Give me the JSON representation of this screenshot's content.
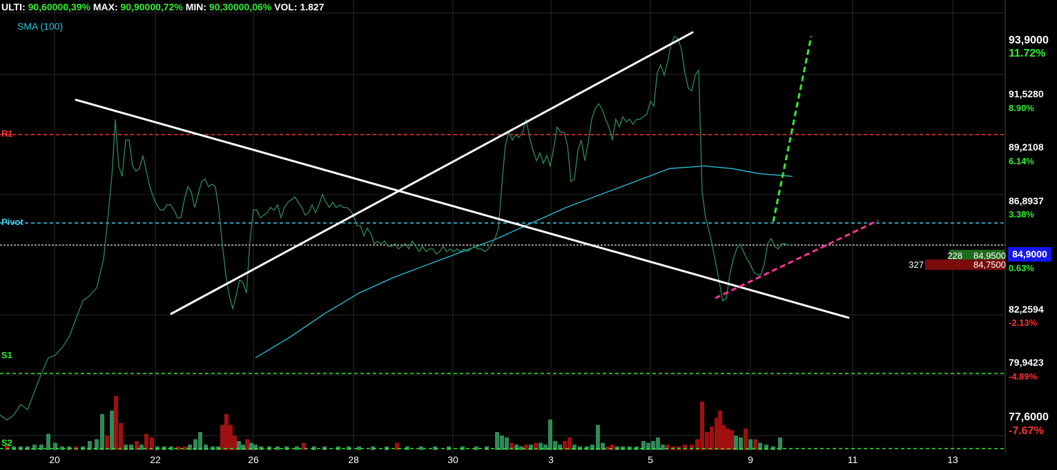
{
  "header": {
    "ulti_label": "ULTI:",
    "ulti_value": "90,60000,39%",
    "max_label": "MAX:",
    "max_value": "90,90000,72%",
    "min_label": "MIN:",
    "min_value": "90,30000,06%",
    "vol_label": "VOL:",
    "vol_value": "1.827"
  },
  "sma_label": "SMA (100)",
  "levels": {
    "r1": {
      "label": "R1",
      "value": 89.21,
      "color": "#ff3333"
    },
    "pivot": {
      "label": "Pivot",
      "value": 85.8,
      "color": "#40d0f0"
    },
    "s1": {
      "label": "S1",
      "value": 80.0,
      "color": "#33ee33"
    },
    "s2": {
      "label": "S2",
      "value": 77.1,
      "color": "#33ee33"
    }
  },
  "price_axis": [
    {
      "price": "93,9000",
      "pct": "11.72%",
      "pct_color": "#33ee33",
      "big": true
    },
    {
      "price": "91,5280",
      "pct": "8.90%",
      "pct_color": "#33ee33",
      "big": false
    },
    {
      "price": "89,2108",
      "pct": "6.14%",
      "pct_color": "#33ee33",
      "big": false
    },
    {
      "price": "86,8937",
      "pct": "3.38%",
      "pct_color": "#33ee33",
      "big": false
    },
    {
      "price": "84,9000",
      "pct": "0.63%",
      "pct_color": "#33ee33",
      "big": false
    },
    {
      "price": "82,2594",
      "pct": "-2.13%",
      "pct_color": "#ff3333",
      "big": false
    },
    {
      "price": "79,9423",
      "pct": "-4.89%",
      "pct_color": "#ff3333",
      "big": false
    },
    {
      "price": "77,6000",
      "pct": "-7.67%",
      "pct_color": "#ff3333",
      "big": true
    }
  ],
  "order_book": {
    "bid_qty": "228",
    "bid_price": "84,9500",
    "ask_qty": "327",
    "ask_price": "84,7500"
  },
  "current_price": "84,9000",
  "colors": {
    "up": "#2e8b57",
    "down": "#a01010",
    "price_line": "#2e8b57",
    "sma": "#26c6da",
    "trendline": "#ffffff",
    "green_dash": "#33ee33",
    "pink_dash": "#ff3399",
    "grid": "#2a2a2a"
  },
  "chart_data": {
    "type": "line",
    "xlabel": "",
    "ylabel": "",
    "x_ticks": [
      "20",
      "22",
      "26",
      "28",
      "30",
      "3",
      "5",
      "9",
      "11",
      "13"
    ],
    "ylim": [
      77.1,
      94.4
    ],
    "grid": true,
    "price_series": [
      [
        0,
        78.4
      ],
      [
        10,
        78.2
      ],
      [
        20,
        78.4
      ],
      [
        30,
        78.8
      ],
      [
        40,
        78.6
      ],
      [
        50,
        79.3
      ],
      [
        60,
        80.0
      ],
      [
        70,
        80.6
      ],
      [
        80,
        80.7
      ],
      [
        90,
        81.0
      ],
      [
        100,
        81.4
      ],
      [
        110,
        82.1
      ],
      [
        120,
        82.8
      ],
      [
        130,
        83.0
      ],
      [
        140,
        83.3
      ],
      [
        150,
        84.4
      ],
      [
        157,
        86.2
      ],
      [
        162,
        87.6
      ],
      [
        167,
        89.8
      ],
      [
        172,
        88.0
      ],
      [
        177,
        87.6
      ],
      [
        182,
        89.0
      ],
      [
        187,
        89.0
      ],
      [
        192,
        88.0
      ],
      [
        197,
        87.8
      ],
      [
        202,
        87.9
      ],
      [
        207,
        88.4
      ],
      [
        212,
        87.8
      ],
      [
        217,
        87.2
      ],
      [
        222,
        86.8
      ],
      [
        227,
        86.5
      ],
      [
        232,
        86.3
      ],
      [
        237,
        86.3
      ],
      [
        242,
        86.5
      ],
      [
        247,
        86.5
      ],
      [
        252,
        86.3
      ],
      [
        257,
        86.0
      ],
      [
        262,
        86.0
      ],
      [
        267,
        86.7
      ],
      [
        272,
        87.2
      ],
      [
        277,
        87.0
      ],
      [
        282,
        86.4
      ],
      [
        287,
        86.9
      ],
      [
        292,
        87.4
      ],
      [
        297,
        87.5
      ],
      [
        302,
        87.2
      ],
      [
        307,
        87.3
      ],
      [
        312,
        87.2
      ],
      [
        317,
        86.3
      ],
      [
        322,
        85.0
      ],
      [
        327,
        83.8
      ],
      [
        332,
        83.0
      ],
      [
        337,
        82.5
      ],
      [
        342,
        83.0
      ],
      [
        347,
        83.6
      ],
      [
        352,
        83.5
      ],
      [
        357,
        83.1
      ],
      [
        362,
        85.1
      ],
      [
        367,
        86.3
      ],
      [
        372,
        86.3
      ],
      [
        377,
        86.0
      ],
      [
        382,
        86.1
      ],
      [
        387,
        86.2
      ],
      [
        392,
        86.4
      ],
      [
        397,
        86.3
      ],
      [
        402,
        86.5
      ],
      [
        407,
        86.0
      ],
      [
        412,
        86.4
      ],
      [
        417,
        86.6
      ],
      [
        422,
        86.7
      ],
      [
        427,
        86.8
      ],
      [
        432,
        86.6
      ],
      [
        437,
        86.4
      ],
      [
        442,
        86.1
      ],
      [
        447,
        86.2
      ],
      [
        452,
        86.5
      ],
      [
        457,
        86.2
      ],
      [
        462,
        86.5
      ],
      [
        467,
        86.9
      ],
      [
        472,
        86.6
      ],
      [
        477,
        86.4
      ],
      [
        482,
        86.6
      ],
      [
        487,
        86.4
      ],
      [
        492,
        86.5
      ],
      [
        497,
        86.4
      ],
      [
        502,
        86.4
      ],
      [
        507,
        86.3
      ],
      [
        512,
        86.1
      ],
      [
        517,
        85.7
      ],
      [
        522,
        85.7
      ],
      [
        527,
        85.3
      ],
      [
        532,
        85.6
      ],
      [
        537,
        85.4
      ],
      [
        542,
        85.0
      ],
      [
        547,
        85.1
      ],
      [
        552,
        85.0
      ],
      [
        557,
        85.1
      ],
      [
        562,
        84.9
      ],
      [
        567,
        84.9
      ],
      [
        572,
        85.0
      ],
      [
        577,
        84.8
      ],
      [
        582,
        84.9
      ],
      [
        587,
        85.0
      ],
      [
        592,
        84.8
      ],
      [
        597,
        85.1
      ],
      [
        602,
        84.9
      ],
      [
        607,
        84.7
      ],
      [
        612,
        84.9
      ],
      [
        617,
        84.7
      ],
      [
        622,
        84.8
      ],
      [
        627,
        84.8
      ],
      [
        632,
        84.6
      ],
      [
        637,
        84.7
      ],
      [
        642,
        84.9
      ],
      [
        647,
        84.7
      ],
      [
        652,
        84.8
      ],
      [
        657,
        84.7
      ],
      [
        662,
        84.8
      ],
      [
        667,
        84.7
      ],
      [
        672,
        84.8
      ],
      [
        677,
        84.7
      ],
      [
        682,
        84.8
      ],
      [
        687,
        84.9
      ],
      [
        692,
        84.8
      ],
      [
        697,
        84.8
      ],
      [
        702,
        84.7
      ],
      [
        707,
        84.8
      ],
      [
        712,
        85.0
      ],
      [
        717,
        85.2
      ],
      [
        722,
        85.6
      ],
      [
        727,
        87.3
      ],
      [
        732,
        88.8
      ],
      [
        737,
        89.3
      ],
      [
        742,
        89.0
      ],
      [
        747,
        89.2
      ],
      [
        752,
        89.1
      ],
      [
        757,
        89.3
      ],
      [
        762,
        89.8
      ],
      [
        767,
        89.1
      ],
      [
        772,
        88.6
      ],
      [
        777,
        88.2
      ],
      [
        782,
        88.5
      ],
      [
        787,
        88.1
      ],
      [
        792,
        88.4
      ],
      [
        797,
        88.0
      ],
      [
        802,
        88.7
      ],
      [
        807,
        89.5
      ],
      [
        812,
        89.3
      ],
      [
        817,
        89.3
      ],
      [
        822,
        88.8
      ],
      [
        827,
        87.4
      ],
      [
        832,
        87.5
      ],
      [
        837,
        88.6
      ],
      [
        842,
        89.0
      ],
      [
        847,
        88.2
      ],
      [
        852,
        88.9
      ],
      [
        857,
        89.8
      ],
      [
        862,
        90.2
      ],
      [
        867,
        90.4
      ],
      [
        872,
        90.2
      ],
      [
        877,
        89.8
      ],
      [
        882,
        89.5
      ],
      [
        887,
        89.0
      ],
      [
        892,
        89.8
      ],
      [
        897,
        89.5
      ],
      [
        902,
        89.9
      ],
      [
        907,
        89.7
      ],
      [
        912,
        89.8
      ],
      [
        917,
        89.6
      ],
      [
        922,
        89.8
      ],
      [
        927,
        89.8
      ],
      [
        932,
        89.9
      ],
      [
        937,
        90.0
      ],
      [
        942,
        90.5
      ],
      [
        947,
        90.3
      ],
      [
        952,
        91.6
      ],
      [
        957,
        91.9
      ],
      [
        962,
        91.5
      ],
      [
        967,
        92.0
      ],
      [
        972,
        92.7
      ],
      [
        977,
        93.0
      ],
      [
        982,
        92.9
      ],
      [
        987,
        92.5
      ],
      [
        992,
        91.6
      ],
      [
        997,
        91.0
      ],
      [
        1002,
        90.9
      ],
      [
        1007,
        91.5
      ],
      [
        1012,
        91.7
      ],
      [
        1017,
        87.0
      ],
      [
        1022,
        86.0
      ],
      [
        1027,
        85.5
      ],
      [
        1032,
        84.9
      ],
      [
        1037,
        84.2
      ],
      [
        1042,
        83.5
      ],
      [
        1047,
        82.8
      ],
      [
        1052,
        82.9
      ],
      [
        1057,
        83.8
      ],
      [
        1062,
        84.4
      ],
      [
        1067,
        84.8
      ],
      [
        1072,
        85.0
      ],
      [
        1077,
        84.7
      ],
      [
        1082,
        84.4
      ],
      [
        1087,
        84.2
      ],
      [
        1092,
        83.9
      ],
      [
        1097,
        83.8
      ],
      [
        1102,
        83.8
      ],
      [
        1107,
        84.2
      ],
      [
        1112,
        85.0
      ],
      [
        1117,
        85.2
      ],
      [
        1122,
        84.9
      ],
      [
        1127,
        84.8
      ],
      [
        1132,
        85.0
      ],
      [
        1137,
        85.0
      ],
      [
        1142,
        84.95
      ]
    ],
    "sma_series": [
      [
        370,
        80.6
      ],
      [
        420,
        81.4
      ],
      [
        470,
        82.3
      ],
      [
        520,
        83.1
      ],
      [
        570,
        83.7
      ],
      [
        620,
        84.2
      ],
      [
        670,
        84.7
      ],
      [
        720,
        85.2
      ],
      [
        770,
        85.8
      ],
      [
        820,
        86.4
      ],
      [
        870,
        86.9
      ],
      [
        920,
        87.4
      ],
      [
        970,
        87.9
      ],
      [
        1020,
        88.0
      ],
      [
        1060,
        87.9
      ],
      [
        1100,
        87.7
      ],
      [
        1148,
        87.6
      ]
    ],
    "trendlines": [
      {
        "from": [
          110,
          90.55
        ],
        "to": [
          1229,
          82.15
        ]
      },
      {
        "from": [
          248,
          82.3
        ],
        "to": [
          1003,
          93.15
        ]
      }
    ],
    "projections": [
      {
        "from": [
          1120,
          85.85
        ],
        "to": [
          1175,
          93.0
        ],
        "color": "green"
      },
      {
        "from": [
          1036,
          82.9
        ],
        "to": [
          1272,
          85.9
        ],
        "color": "pink"
      }
    ],
    "volume_bars": [
      [
        10,
        0.3,
        "down"
      ],
      [
        20,
        0.2,
        "up"
      ],
      [
        30,
        0.2,
        "up"
      ],
      [
        40,
        0.2,
        "up"
      ],
      [
        50,
        0.3,
        "up"
      ],
      [
        60,
        0.3,
        "up"
      ],
      [
        70,
        0.9,
        "up"
      ],
      [
        80,
        0.4,
        "up"
      ],
      [
        90,
        0.2,
        "up"
      ],
      [
        100,
        0.2,
        "up"
      ],
      [
        110,
        0.2,
        "down"
      ],
      [
        120,
        0.2,
        "up"
      ],
      [
        130,
        0.5,
        "up"
      ],
      [
        140,
        0.6,
        "up"
      ],
      [
        148,
        2.0,
        "up"
      ],
      [
        155,
        0.8,
        "down"
      ],
      [
        162,
        2.2,
        "up"
      ],
      [
        168,
        3.0,
        "down"
      ],
      [
        175,
        1.5,
        "down"
      ],
      [
        182,
        0.3,
        "up"
      ],
      [
        190,
        0.3,
        "up"
      ],
      [
        198,
        0.5,
        "down"
      ],
      [
        205,
        0.3,
        "up"
      ],
      [
        212,
        0.9,
        "down"
      ],
      [
        220,
        0.7,
        "down"
      ],
      [
        228,
        0.2,
        "up"
      ],
      [
        238,
        0.2,
        "up"
      ],
      [
        248,
        0.2,
        "up"
      ],
      [
        258,
        0.2,
        "down"
      ],
      [
        268,
        0.2,
        "down"
      ],
      [
        275,
        0.3,
        "up"
      ],
      [
        283,
        0.6,
        "up"
      ],
      [
        290,
        1.0,
        "up"
      ],
      [
        298,
        0.3,
        "up"
      ],
      [
        308,
        0.2,
        "up"
      ],
      [
        316,
        0.2,
        "up"
      ],
      [
        322,
        1.4,
        "down"
      ],
      [
        328,
        2.0,
        "down"
      ],
      [
        334,
        1.4,
        "down"
      ],
      [
        340,
        0.8,
        "down"
      ],
      [
        346,
        0.5,
        "up"
      ],
      [
        352,
        0.3,
        "up"
      ],
      [
        358,
        0.6,
        "down"
      ],
      [
        364,
        0.4,
        "up"
      ],
      [
        370,
        0.3,
        "up"
      ],
      [
        378,
        0.2,
        "up"
      ],
      [
        390,
        0.2,
        "up"
      ],
      [
        402,
        0.2,
        "up"
      ],
      [
        415,
        0.2,
        "up"
      ],
      [
        430,
        0.2,
        "up"
      ],
      [
        440,
        0.4,
        "down"
      ],
      [
        455,
        0.2,
        "up"
      ],
      [
        470,
        0.2,
        "up"
      ],
      [
        490,
        0.2,
        "up"
      ],
      [
        505,
        0.2,
        "up"
      ],
      [
        520,
        0.2,
        "up"
      ],
      [
        540,
        0.2,
        "up"
      ],
      [
        560,
        0.2,
        "up"
      ],
      [
        575,
        0.4,
        "down"
      ],
      [
        590,
        0.2,
        "up"
      ],
      [
        610,
        0.2,
        "up"
      ],
      [
        630,
        0.2,
        "up"
      ],
      [
        650,
        0.2,
        "up"
      ],
      [
        670,
        0.2,
        "up"
      ],
      [
        690,
        0.2,
        "up"
      ],
      [
        705,
        0.2,
        "up"
      ],
      [
        720,
        1.0,
        "up"
      ],
      [
        727,
        0.8,
        "up"
      ],
      [
        734,
        0.7,
        "up"
      ],
      [
        741,
        0.4,
        "down"
      ],
      [
        748,
        0.3,
        "up"
      ],
      [
        755,
        0.2,
        "up"
      ],
      [
        762,
        0.3,
        "down"
      ],
      [
        769,
        0.3,
        "up"
      ],
      [
        776,
        0.4,
        "down"
      ],
      [
        783,
        0.4,
        "up"
      ],
      [
        790,
        0.3,
        "up"
      ],
      [
        797,
        1.7,
        "up"
      ],
      [
        804,
        0.5,
        "up"
      ],
      [
        811,
        0.3,
        "up"
      ],
      [
        818,
        0.5,
        "down"
      ],
      [
        825,
        0.7,
        "down"
      ],
      [
        832,
        0.3,
        "up"
      ],
      [
        840,
        0.2,
        "up"
      ],
      [
        850,
        0.2,
        "up"
      ],
      [
        858,
        0.3,
        "up"
      ],
      [
        866,
        1.4,
        "up"
      ],
      [
        873,
        0.4,
        "up"
      ],
      [
        880,
        0.2,
        "down"
      ],
      [
        887,
        0.3,
        "down"
      ],
      [
        894,
        0.2,
        "up"
      ],
      [
        902,
        0.2,
        "up"
      ],
      [
        912,
        0.2,
        "up"
      ],
      [
        922,
        0.2,
        "up"
      ],
      [
        932,
        0.5,
        "up"
      ],
      [
        939,
        0.4,
        "up"
      ],
      [
        946,
        0.5,
        "up"
      ],
      [
        953,
        0.7,
        "up"
      ],
      [
        960,
        0.3,
        "up"
      ],
      [
        967,
        0.3,
        "down"
      ],
      [
        975,
        0.2,
        "down"
      ],
      [
        983,
        0.2,
        "down"
      ],
      [
        992,
        0.3,
        "down"
      ],
      [
        1002,
        0.3,
        "down"
      ],
      [
        1010,
        0.6,
        "down"
      ],
      [
        1017,
        2.7,
        "down"
      ],
      [
        1024,
        1.0,
        "down"
      ],
      [
        1031,
        1.3,
        "down"
      ],
      [
        1038,
        1.8,
        "down"
      ],
      [
        1043,
        2.2,
        "down"
      ],
      [
        1048,
        1.4,
        "down"
      ],
      [
        1054,
        1.2,
        "down"
      ],
      [
        1060,
        1.1,
        "down"
      ],
      [
        1066,
        0.8,
        "up"
      ],
      [
        1073,
        0.7,
        "up"
      ],
      [
        1080,
        1.2,
        "down"
      ],
      [
        1087,
        0.6,
        "up"
      ],
      [
        1094,
        0.6,
        "down"
      ],
      [
        1101,
        0.4,
        "up"
      ],
      [
        1110,
        0.3,
        "up"
      ],
      [
        1120,
        0.2,
        "up"
      ],
      [
        1130,
        0.7,
        "up"
      ]
    ]
  }
}
